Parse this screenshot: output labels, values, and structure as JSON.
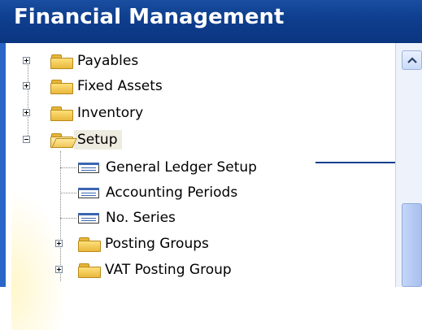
{
  "window": {
    "title": "Financial Management"
  },
  "tree": {
    "items": [
      {
        "label": "Payables",
        "type": "folder",
        "state": "collapsed"
      },
      {
        "label": "Fixed Assets",
        "type": "folder",
        "state": "collapsed"
      },
      {
        "label": "Inventory",
        "type": "folder",
        "state": "collapsed"
      },
      {
        "label": "Setup",
        "type": "folder",
        "state": "expanded",
        "selected": true
      },
      {
        "label": "General Ledger Setup",
        "type": "form"
      },
      {
        "label": "Accounting Periods",
        "type": "form"
      },
      {
        "label": "No. Series",
        "type": "form"
      },
      {
        "label": "Posting Groups",
        "type": "folder",
        "state": "collapsed"
      },
      {
        "label": "VAT Posting Group",
        "type": "folder",
        "state": "collapsed"
      }
    ]
  },
  "icons": {
    "folder": "folder-icon",
    "open_folder": "folder-open-icon",
    "form": "form-icon",
    "expand": "plus-box-icon",
    "collapse": "minus-box-icon",
    "scroll_up": "chevron-up-icon"
  },
  "colors": {
    "title_bar": "#0f3f8f",
    "title_text": "#ffffff",
    "selection": "#eeebe0",
    "pointer_line": "#0d3f90",
    "scrollbar_thumb": "#b6cbf3"
  }
}
